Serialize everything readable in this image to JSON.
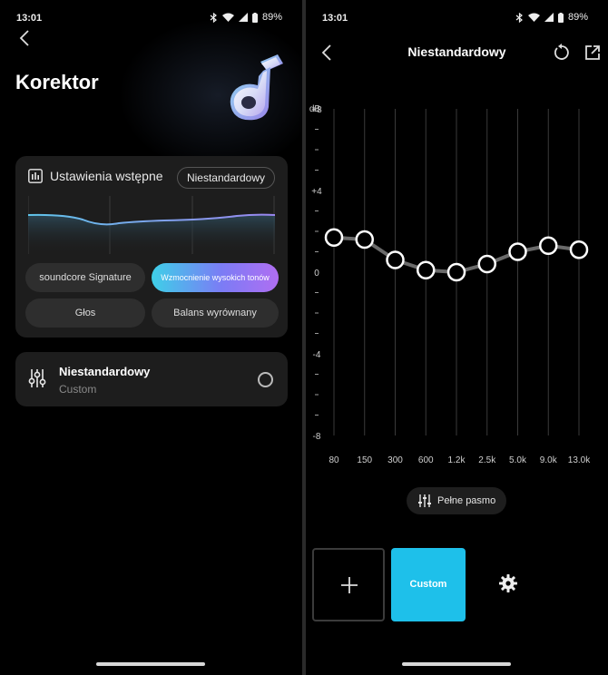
{
  "left": {
    "status": {
      "time": "13:01",
      "battery": "89%"
    },
    "title": "Korektor",
    "presets": {
      "header": "Ustawienia wstępne",
      "current": "Niestandardowy",
      "buttons": [
        {
          "label": "soundcore Signature"
        },
        {
          "label": "Wzmocnienie wysokich tonów",
          "active": true
        },
        {
          "label": "Głos"
        },
        {
          "label": "Balans wyrównany"
        }
      ]
    },
    "custom": {
      "name": "Niestandardowy",
      "subtitle": "Custom",
      "selected": false
    }
  },
  "right": {
    "status": {
      "time": "13:01",
      "battery": "89%"
    },
    "title": "Niestandardowy",
    "eq": {
      "unit": "dB",
      "scale_labels": [
        "+8",
        "+4",
        "0",
        "-4",
        "-8"
      ],
      "db_min": -8,
      "db_max": 8,
      "bands": [
        "80",
        "150",
        "300",
        "600",
        "1.2k",
        "2.5k",
        "5.0k",
        "9.0k",
        "13.0k"
      ],
      "gains_db": [
        1.7,
        1.6,
        0.6,
        0.1,
        0.0,
        0.4,
        1.0,
        1.3,
        1.1
      ]
    },
    "full_band_label": "Pełne pasmo",
    "custom_tile_label": "Custom"
  },
  "colors": {
    "accent": "#1ec0ea",
    "gradient_start": "#3ed0e8",
    "gradient_end": "#b06ef2",
    "card_bg": "#1d1d1d"
  },
  "icons": {
    "back": "chevron-left-icon",
    "bluetooth": "bluetooth-icon",
    "wifi": "wifi-icon",
    "signal": "signal-icon",
    "battery": "battery-icon",
    "logo": "soundcore-logo-icon",
    "eq": "equalizer-icon",
    "reset": "reset-icon",
    "export": "export-icon",
    "sliders": "sliders-icon",
    "add": "plus-icon",
    "settings": "gear-icon"
  }
}
